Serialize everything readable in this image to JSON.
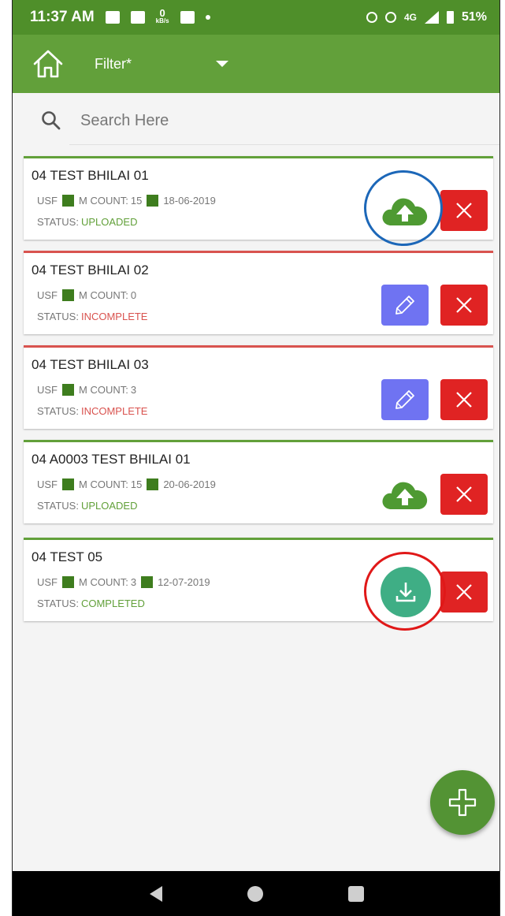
{
  "status_bar": {
    "time": "11:37 AM",
    "speed_value": "0",
    "speed_unit": "kB/s",
    "network": "4G",
    "battery": "51%"
  },
  "app_bar": {
    "home_icon": "home-icon",
    "filter_label": "Filter*",
    "dropdown_icon": "caret-down-icon",
    "color": "#62a03a"
  },
  "search": {
    "placeholder": "Search Here",
    "icon": "search-icon"
  },
  "colors": {
    "uploaded": "#62a03a",
    "incomplete": "#d9534f",
    "edit_button": "#6f73f2",
    "delete_button": "#e02323",
    "download_button": "#3fae85"
  },
  "items": [
    {
      "title": "04 TEST BHILAI 01",
      "type": "USF",
      "count_label": "M COUNT:",
      "count": "15",
      "date": "18-06-2019",
      "status_label": "STATUS:",
      "status": "UPLOADED",
      "action": "upload"
    },
    {
      "title": "04 TEST BHILAI 02",
      "type": "USF",
      "count_label": "M COUNT:",
      "count": "0",
      "date": "",
      "status_label": "STATUS:",
      "status": "INCOMPLETE",
      "action": "edit"
    },
    {
      "title": "04 TEST BHILAI 03",
      "type": "USF",
      "count_label": "M COUNT:",
      "count": "3",
      "date": "",
      "status_label": "STATUS:",
      "status": "INCOMPLETE",
      "action": "edit"
    },
    {
      "title": "04 A0003 TEST BHILAI 01",
      "type": "USF",
      "count_label": "M COUNT:",
      "count": "15",
      "date": "20-06-2019",
      "status_label": "STATUS:",
      "status": "UPLOADED",
      "action": "upload"
    },
    {
      "title": "04 TEST 05",
      "type": "USF",
      "count_label": "M COUNT:",
      "count": "3",
      "date": "12-07-2019",
      "status_label": "STATUS:",
      "status": "COMPLETED",
      "action": "download"
    }
  ],
  "fab": {
    "icon": "plus-icon"
  },
  "nav_bar": {
    "back_icon": "back-icon",
    "home_icon": "home-circle-icon",
    "recents_icon": "recents-icon"
  }
}
